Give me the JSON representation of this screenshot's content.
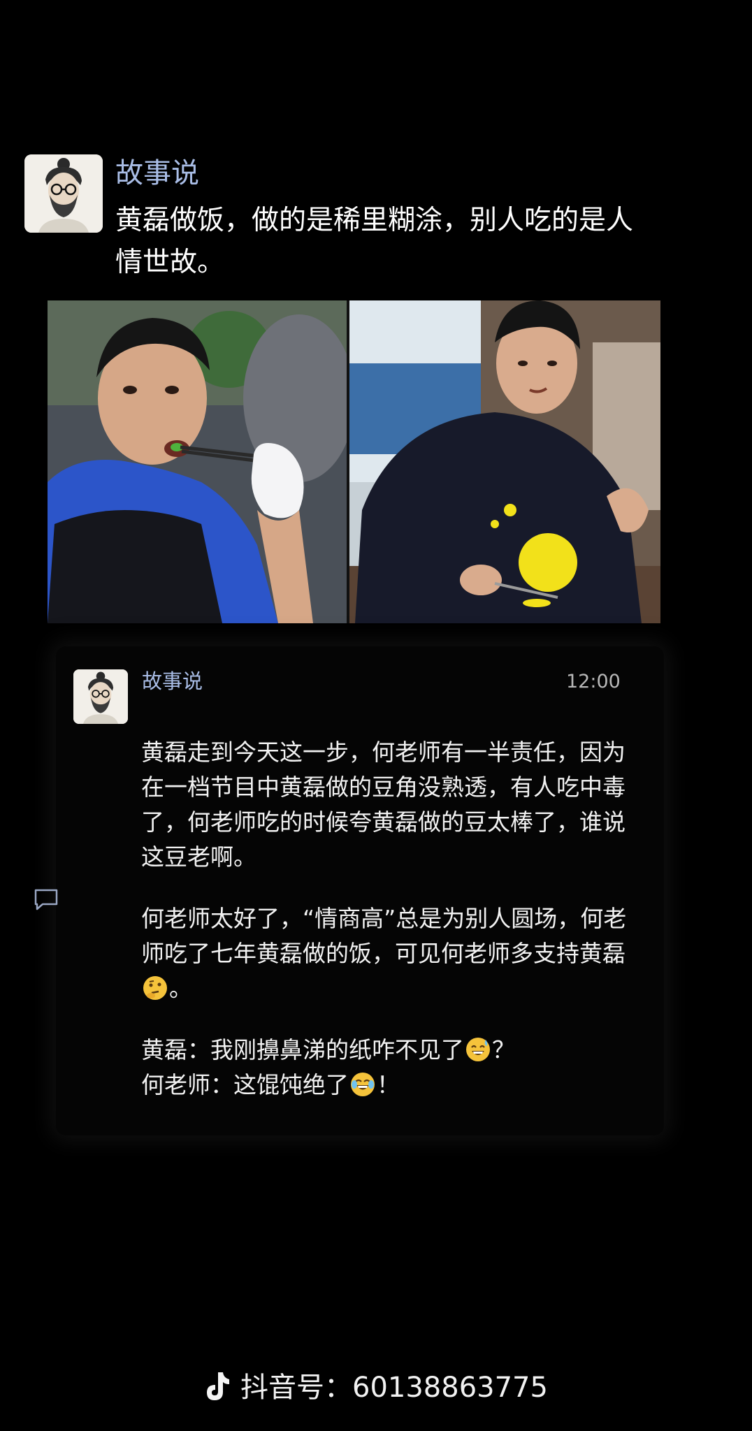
{
  "post": {
    "author": "故事说",
    "title": "黄磊做饭，做的是稀里糊涂，别人吃的是人情世故。",
    "avatar_icon": "illustrated-man-avatar",
    "photo_description_icon": "two-men-cooking-photo"
  },
  "comment": {
    "author": "故事说",
    "time": "12:00",
    "paragraph_1": "黄磊走到今天这一步，何老师有一半责任，因为在一档节目中黄磊做的豆角没熟透，有人吃中毒了，何老师吃的时候夸黄磊做的豆太棒了，谁说这豆老啊。",
    "paragraph_2": "何老师太好了，“情商高”总是为别人圆场，何老师吃了七年黄磊做的饭，可见何老师多支持黄磊",
    "paragraph_2_end": "。",
    "line_3a": "黄磊：我刚擤鼻涕的纸咋不见了",
    "line_3a_end": "？",
    "line_3b": "何老师：这馄饨绝了",
    "line_3b_end": "！",
    "emoji_thinking": "thinking-face-emoji",
    "emoji_sweat": "grinning-sweat-emoji",
    "emoji_laugh": "tears-of-joy-emoji"
  },
  "footer": {
    "label": "抖音号：60138863775",
    "icon": "tiktok-icon"
  },
  "colors": {
    "background": "#000000",
    "author_name": "#a9bde6",
    "body_text": "#f2f2f2",
    "time_text": "#b8b8b8"
  }
}
